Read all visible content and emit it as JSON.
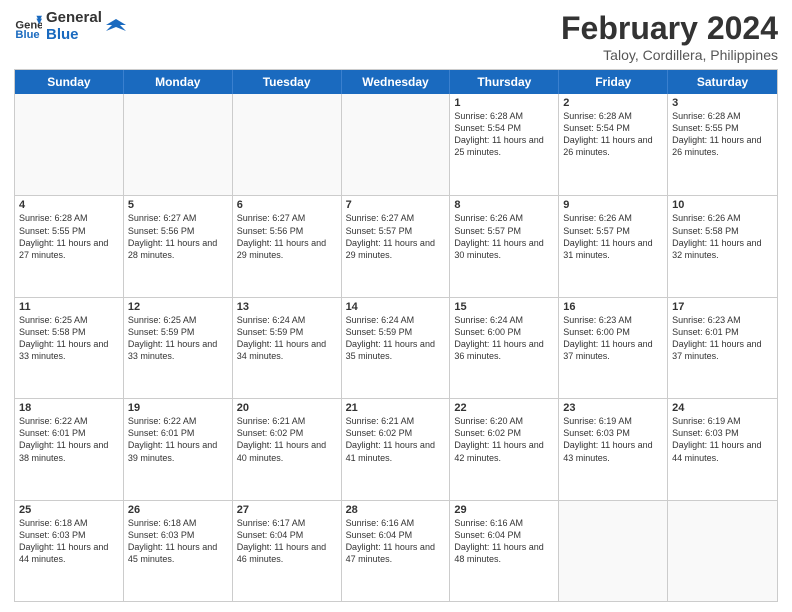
{
  "header": {
    "logo_line1": "General",
    "logo_line2": "Blue",
    "month_year": "February 2024",
    "location": "Taloy, Cordillera, Philippines"
  },
  "weekdays": [
    "Sunday",
    "Monday",
    "Tuesday",
    "Wednesday",
    "Thursday",
    "Friday",
    "Saturday"
  ],
  "rows": [
    [
      {
        "day": "",
        "empty": true
      },
      {
        "day": "",
        "empty": true
      },
      {
        "day": "",
        "empty": true
      },
      {
        "day": "",
        "empty": true
      },
      {
        "day": "1",
        "rise": "6:28 AM",
        "set": "5:54 PM",
        "daylight": "11 hours and 25 minutes."
      },
      {
        "day": "2",
        "rise": "6:28 AM",
        "set": "5:54 PM",
        "daylight": "11 hours and 26 minutes."
      },
      {
        "day": "3",
        "rise": "6:28 AM",
        "set": "5:55 PM",
        "daylight": "11 hours and 26 minutes."
      }
    ],
    [
      {
        "day": "4",
        "rise": "6:28 AM",
        "set": "5:55 PM",
        "daylight": "11 hours and 27 minutes."
      },
      {
        "day": "5",
        "rise": "6:27 AM",
        "set": "5:56 PM",
        "daylight": "11 hours and 28 minutes."
      },
      {
        "day": "6",
        "rise": "6:27 AM",
        "set": "5:56 PM",
        "daylight": "11 hours and 29 minutes."
      },
      {
        "day": "7",
        "rise": "6:27 AM",
        "set": "5:57 PM",
        "daylight": "11 hours and 29 minutes."
      },
      {
        "day": "8",
        "rise": "6:26 AM",
        "set": "5:57 PM",
        "daylight": "11 hours and 30 minutes."
      },
      {
        "day": "9",
        "rise": "6:26 AM",
        "set": "5:57 PM",
        "daylight": "11 hours and 31 minutes."
      },
      {
        "day": "10",
        "rise": "6:26 AM",
        "set": "5:58 PM",
        "daylight": "11 hours and 32 minutes."
      }
    ],
    [
      {
        "day": "11",
        "rise": "6:25 AM",
        "set": "5:58 PM",
        "daylight": "11 hours and 33 minutes."
      },
      {
        "day": "12",
        "rise": "6:25 AM",
        "set": "5:59 PM",
        "daylight": "11 hours and 33 minutes."
      },
      {
        "day": "13",
        "rise": "6:24 AM",
        "set": "5:59 PM",
        "daylight": "11 hours and 34 minutes."
      },
      {
        "day": "14",
        "rise": "6:24 AM",
        "set": "5:59 PM",
        "daylight": "11 hours and 35 minutes."
      },
      {
        "day": "15",
        "rise": "6:24 AM",
        "set": "6:00 PM",
        "daylight": "11 hours and 36 minutes."
      },
      {
        "day": "16",
        "rise": "6:23 AM",
        "set": "6:00 PM",
        "daylight": "11 hours and 37 minutes."
      },
      {
        "day": "17",
        "rise": "6:23 AM",
        "set": "6:01 PM",
        "daylight": "11 hours and 37 minutes."
      }
    ],
    [
      {
        "day": "18",
        "rise": "6:22 AM",
        "set": "6:01 PM",
        "daylight": "11 hours and 38 minutes."
      },
      {
        "day": "19",
        "rise": "6:22 AM",
        "set": "6:01 PM",
        "daylight": "11 hours and 39 minutes."
      },
      {
        "day": "20",
        "rise": "6:21 AM",
        "set": "6:02 PM",
        "daylight": "11 hours and 40 minutes."
      },
      {
        "day": "21",
        "rise": "6:21 AM",
        "set": "6:02 PM",
        "daylight": "11 hours and 41 minutes."
      },
      {
        "day": "22",
        "rise": "6:20 AM",
        "set": "6:02 PM",
        "daylight": "11 hours and 42 minutes."
      },
      {
        "day": "23",
        "rise": "6:19 AM",
        "set": "6:03 PM",
        "daylight": "11 hours and 43 minutes."
      },
      {
        "day": "24",
        "rise": "6:19 AM",
        "set": "6:03 PM",
        "daylight": "11 hours and 44 minutes."
      }
    ],
    [
      {
        "day": "25",
        "rise": "6:18 AM",
        "set": "6:03 PM",
        "daylight": "11 hours and 44 minutes."
      },
      {
        "day": "26",
        "rise": "6:18 AM",
        "set": "6:03 PM",
        "daylight": "11 hours and 45 minutes."
      },
      {
        "day": "27",
        "rise": "6:17 AM",
        "set": "6:04 PM",
        "daylight": "11 hours and 46 minutes."
      },
      {
        "day": "28",
        "rise": "6:16 AM",
        "set": "6:04 PM",
        "daylight": "11 hours and 47 minutes."
      },
      {
        "day": "29",
        "rise": "6:16 AM",
        "set": "6:04 PM",
        "daylight": "11 hours and 48 minutes."
      },
      {
        "day": "",
        "empty": true
      },
      {
        "day": "",
        "empty": true
      }
    ]
  ]
}
